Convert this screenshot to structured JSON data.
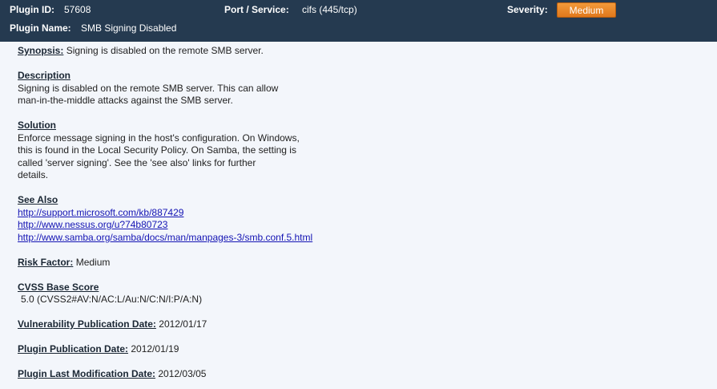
{
  "header": {
    "plugin_id_label": "Plugin ID:",
    "plugin_id": "57608",
    "port_label": "Port / Service:",
    "port": "cifs (445/tcp)",
    "severity_label": "Severity:",
    "severity": "Medium",
    "plugin_name_label": "Plugin Name:",
    "plugin_name": "SMB Signing Disabled"
  },
  "synopsis": {
    "label": "Synopsis:",
    "text": "Signing is disabled on the remote SMB server."
  },
  "description": {
    "label": "Description",
    "lines": [
      "Signing is disabled on the remote SMB server.  This can allow",
      "man-in-the-middle attacks against the SMB server."
    ]
  },
  "solution": {
    "label": "Solution",
    "lines": [
      "Enforce message signing in the host's configuration.  On Windows,",
      "this is found in the Local Security Policy.  On Samba, the setting is",
      "called 'server signing'.  See the 'see also' links for further",
      "details."
    ]
  },
  "see_also": {
    "label": "See Also",
    "links": [
      "http://support.microsoft.com/kb/887429",
      "http://www.nessus.org/u?74b80723",
      "http://www.samba.org/samba/docs/man/manpages-3/smb.conf.5.html"
    ]
  },
  "risk_factor": {
    "label": "Risk Factor:",
    "value": "Medium"
  },
  "cvss": {
    "label": "CVSS Base Score",
    "value": "5.0 (CVSS2#AV:N/AC:L/Au:N/C:N/I:P/A:N)"
  },
  "vuln_pub_date": {
    "label": "Vulnerability Publication Date:",
    "value": "2012/01/17"
  },
  "plugin_pub_date": {
    "label": "Plugin Publication Date:",
    "value": "2012/01/19"
  },
  "plugin_mod_date": {
    "label": "Plugin Last Modification Date:",
    "value": "2012/03/05"
  },
  "colors": {
    "header_bg": "#253a50",
    "severity_medium": "#e98a2a",
    "page_bg": "#f3f6fb",
    "link": "#1414b4"
  }
}
